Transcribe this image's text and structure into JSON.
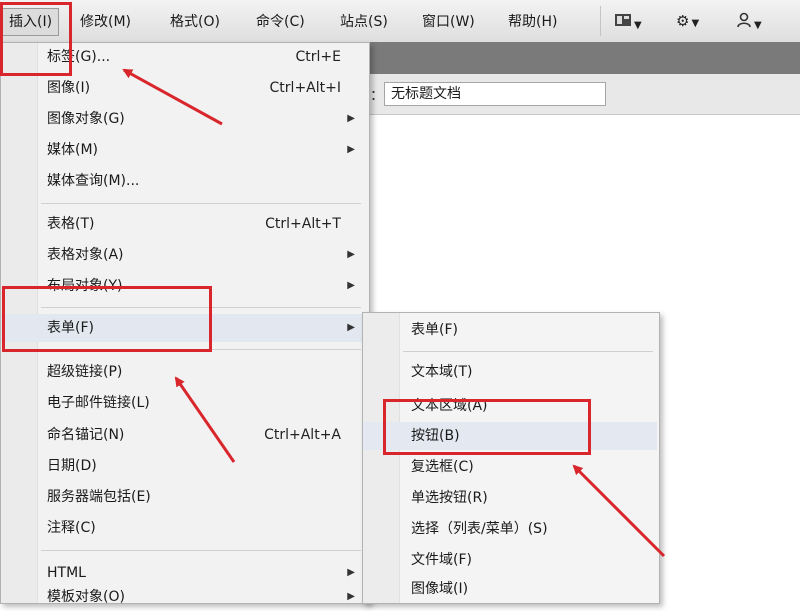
{
  "menubar": {
    "items": [
      "插入(I)",
      "修改(M)",
      "格式(O)",
      "命令(C)",
      "站点(S)",
      "窗口(W)",
      "帮助(H)"
    ],
    "tools": [
      {
        "icon": "layout-grid-icon"
      },
      {
        "icon": "gear-icon"
      },
      {
        "icon": "user-icon"
      }
    ]
  },
  "document": {
    "title_label": "：",
    "title_value": "无标题文档"
  },
  "insert_menu": {
    "items": [
      {
        "label": "标签(G)...",
        "shortcut": "Ctrl+E",
        "submenu": false
      },
      {
        "label": "图像(I)",
        "shortcut": "Ctrl+Alt+I",
        "submenu": false
      },
      {
        "label": "图像对象(G)",
        "shortcut": "",
        "submenu": true
      },
      {
        "label": "媒体(M)",
        "shortcut": "",
        "submenu": true
      },
      {
        "label": "媒体查询(M)...",
        "shortcut": "",
        "submenu": false
      },
      {
        "label": "表格(T)",
        "shortcut": "Ctrl+Alt+T",
        "submenu": false
      },
      {
        "label": "表格对象(A)",
        "shortcut": "",
        "submenu": true
      },
      {
        "label": "布局对象(Y)",
        "shortcut": "",
        "submenu": true
      },
      {
        "label": "表单(F)",
        "shortcut": "",
        "submenu": true
      },
      {
        "label": "超级链接(P)",
        "shortcut": "",
        "submenu": false
      },
      {
        "label": "电子邮件链接(L)",
        "shortcut": "",
        "submenu": false
      },
      {
        "label": "命名锚记(N)",
        "shortcut": "Ctrl+Alt+A",
        "submenu": false
      },
      {
        "label": "日期(D)",
        "shortcut": "",
        "submenu": false
      },
      {
        "label": "服务器端包括(E)",
        "shortcut": "",
        "submenu": false
      },
      {
        "label": "注释(C)",
        "shortcut": "",
        "submenu": false
      },
      {
        "label": "HTML",
        "shortcut": "",
        "submenu": true
      },
      {
        "label": "模板对象(O)",
        "shortcut": "",
        "submenu": true
      }
    ]
  },
  "form_submenu": {
    "items": [
      {
        "label": "表单(F)"
      },
      {
        "label": "文本域(T)"
      },
      {
        "label": "文本区域(A)"
      },
      {
        "label": "按钮(B)"
      },
      {
        "label": "复选框(C)"
      },
      {
        "label": "单选按钮(R)"
      },
      {
        "label": "选择（列表/菜单）(S)"
      },
      {
        "label": "文件域(F)"
      },
      {
        "label": "图像域(I)"
      }
    ]
  },
  "colors": {
    "annotation_red": "#d8262c",
    "menu_bg": "#f2f2f2",
    "hover_bg": "#e3e8f0"
  }
}
